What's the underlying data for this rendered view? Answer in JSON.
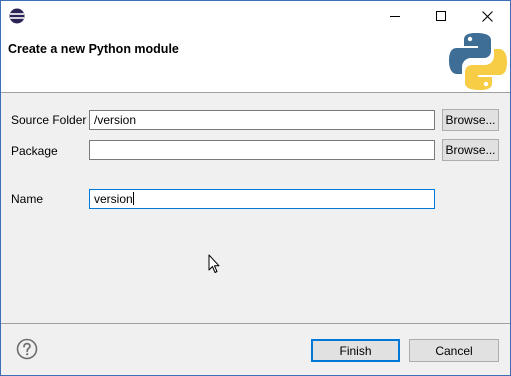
{
  "window": {
    "app_icon": "eclipse-icon",
    "controls": [
      "minimize-icon",
      "maximize-icon",
      "close-icon"
    ]
  },
  "banner": {
    "title": "Create a new Python module",
    "logo": "python-logo"
  },
  "form": {
    "source_folder": {
      "label": "Source Folder",
      "value": "/version",
      "browse_label": "Browse..."
    },
    "package": {
      "label": "Package",
      "value": "",
      "browse_label": "Browse..."
    },
    "name": {
      "label": "Name",
      "value": "version"
    }
  },
  "footer": {
    "help_icon": "question-mark-icon",
    "finish_label": "Finish",
    "cancel_label": "Cancel"
  },
  "colors": {
    "accent": "#0078d7",
    "python_blue": "#3e6e96",
    "python_yellow": "#f6cd45",
    "dialog_bg": "#f0f0f0"
  }
}
